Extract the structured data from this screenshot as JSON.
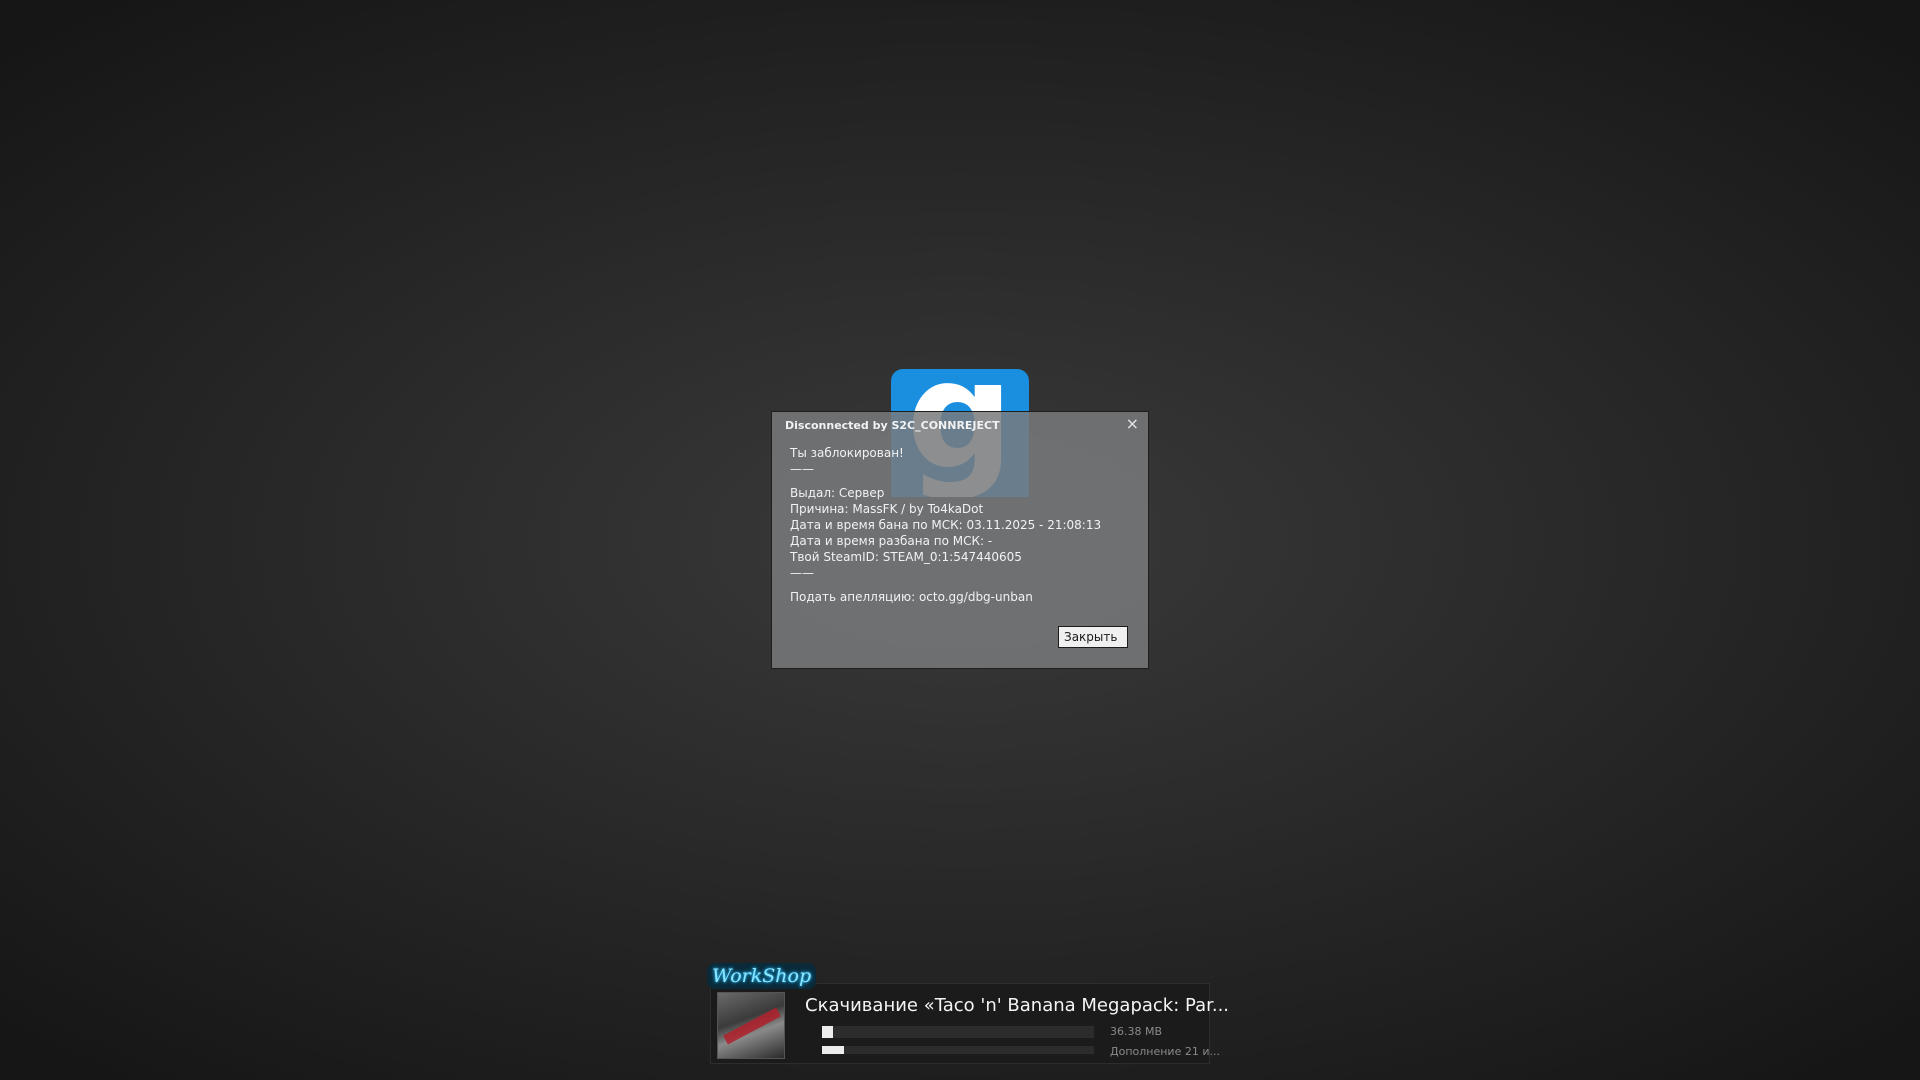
{
  "logo": {
    "letter": "g",
    "color": "#1a8fe0"
  },
  "dialog": {
    "title": "Disconnected by S2C_CONNREJECT",
    "close_icon": "×",
    "lines": [
      "Ты заблокирован!",
      "——",
      "",
      "Выдал: Сервер",
      "Причина: MassFK / by To4kaDot",
      "Дата и время бана по МСК: 03.11.2025 - 21:08:13",
      "Дата и время разбана по МСК: -",
      "Твой SteamID: STEAM_0:1:547440605",
      "——",
      "",
      "Подать апелляцию: octo.gg/dbg-unban"
    ],
    "close_button_label": "Закрыть"
  },
  "workshop": {
    "badge_text": "WorkShop",
    "title": "Скачивание «Taco 'n' Banana Megapack: Par...",
    "size_text": "36.38 MB",
    "progress_text": "Дополнение 21 и...",
    "item_progress": 0.04,
    "overall_progress": 0.08
  }
}
